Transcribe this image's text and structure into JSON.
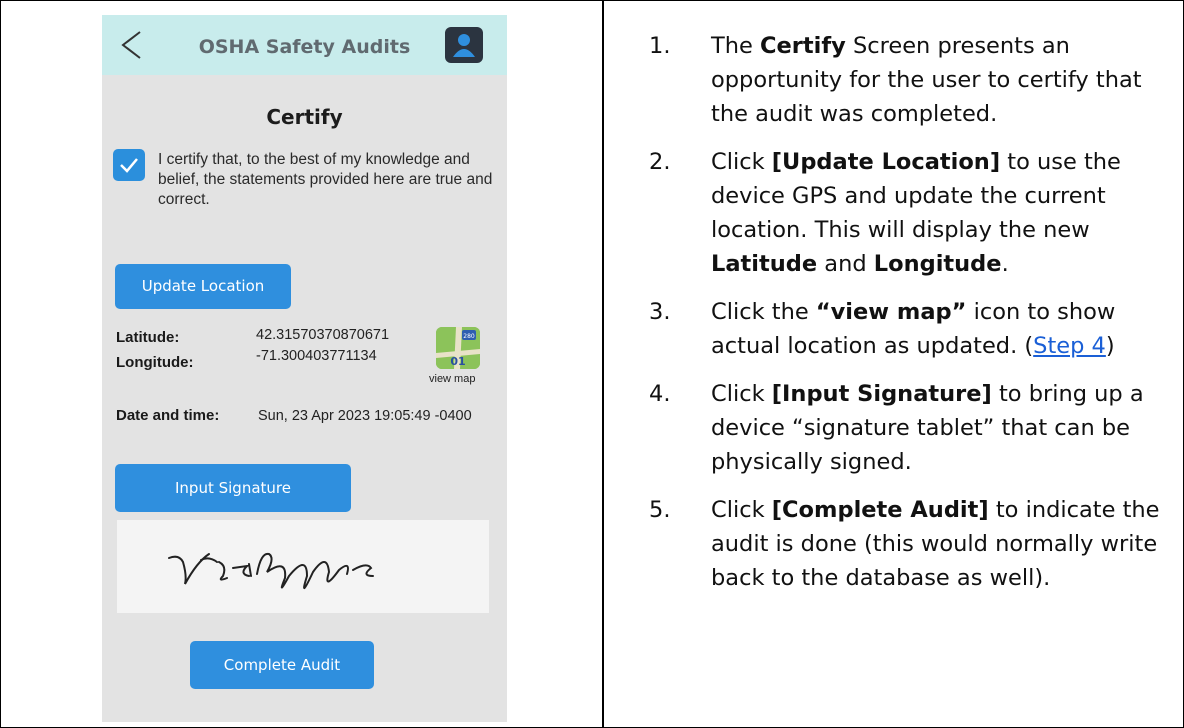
{
  "phone": {
    "app_title": "OSHA Safety Audits",
    "screen_title": "Certify",
    "certify_statement": "I certify that, to the best of my knowledge and belief, the statements provided here are true and correct.",
    "certify_checked": true,
    "update_location_label": "Update Location",
    "latitude_label": "Latitude:",
    "latitude_value": "42.31570370870671",
    "longitude_label": "Longitude:",
    "longitude_value": "-71.300403771134",
    "map_icon_badge": "280",
    "map_icon_number": "01",
    "view_map_label": "view map",
    "datetime_label": "Date and time:",
    "datetime_value": "Sun, 23 Apr 2023 19:05:49 -0400",
    "input_signature_label": "Input Signature",
    "complete_audit_label": "Complete Audit"
  },
  "instructions": [
    {
      "num": "1.",
      "parts": [
        "The ",
        "Certify",
        " Screen presents an opportunity for the user to certify that the audit was completed."
      ]
    },
    {
      "num": "2.",
      "parts": [
        "Click ",
        "[Update Location]",
        " to use the device GPS and update the current location. This will display the new ",
        "Latitude",
        " and ",
        "Longitude",
        "."
      ]
    },
    {
      "num": "3.",
      "parts": [
        "Click the ",
        "“view map”",
        " icon to show actual location as updated. (",
        "Step 4",
        ")"
      ]
    },
    {
      "num": "4.",
      "parts": [
        "Click ",
        "[Input Signature]",
        " to bring up a device “signature tablet” that can be physically signed."
      ]
    },
    {
      "num": "5.",
      "parts": [
        "Click ",
        "[Complete Audit]",
        " to indicate the audit is done (this would normally write back to the database as well)."
      ]
    }
  ],
  "colors": {
    "header_bg": "#c8ecec",
    "button_blue": "#2f8fde",
    "link_blue": "#1a5fd6"
  }
}
